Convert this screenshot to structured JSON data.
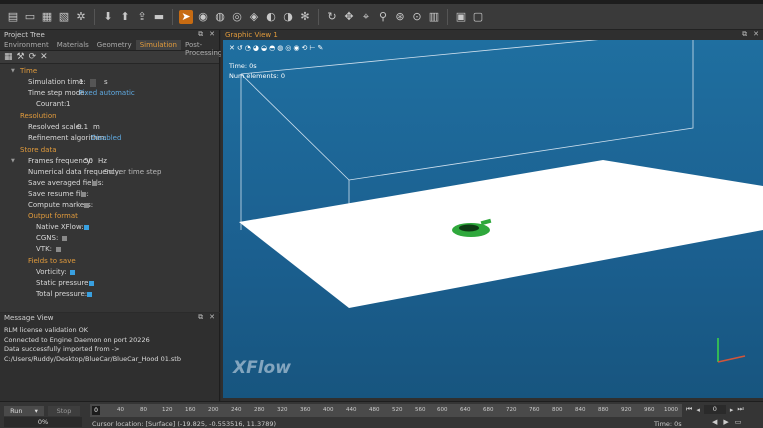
{
  "project_tree": {
    "title": "Project Tree",
    "tabs": [
      "Environment",
      "Materials",
      "Geometry",
      "Simulation",
      "Post-Processing"
    ],
    "active_tab": "Simulation",
    "time_section": "Time",
    "simulation_time_label": "Simulation time:",
    "simulation_time_value": "1",
    "simulation_time_unit": "s",
    "time_step_mode_label": "Time step mode:",
    "time_step_mode_value": "Fixed automatic",
    "courant_label": "Courant:",
    "courant_value": "1",
    "resolution_section": "Resolution",
    "resolved_scale_label": "Resolved scale:",
    "resolved_scale_value": "0.1",
    "resolved_scale_unit": "m",
    "refinement_label": "Refinement algorithm:",
    "refinement_value": "Disabled",
    "store_section": "Store data",
    "frames_freq_label": "Frames frequency:",
    "frames_freq_value": "50",
    "frames_freq_unit": "Hz",
    "numerical_freq_label": "Numerical data frequency:",
    "numerical_freq_value": "Solver time step",
    "save_averaged_label": "Save averaged fields:",
    "save_resume_label": "Save resume file:",
    "compute_markers_label": "Compute markers:",
    "output_format_section": "Output format",
    "native_label": "Native XFlow:",
    "cgns_label": "CGNS:",
    "vtk_label": "VTK:",
    "fields_section": "Fields to save",
    "vorticity_label": "Vorticity:",
    "static_pressure_label": "Static pressure:",
    "total_pressure_label": "Total pressure:"
  },
  "message_view": {
    "title": "Message View",
    "lines": [
      "RLM license validation OK",
      "Connected to Engine Daemon on port 20226",
      "Data successfully imported from ->",
      "C:/Users/Ruddy/Desktop/BlueCar/BlueCar_Hood 01.stb"
    ]
  },
  "graphic_view": {
    "title": "Graphic View 1",
    "time_text": "Time: 0s",
    "elements_text": "Num elements: 0",
    "logo": "XFlow"
  },
  "bottom": {
    "run_label": "Run",
    "stop_label": "Stop",
    "progress_text": "0%",
    "timeline_start": "0",
    "ticks": [
      "40",
      "80",
      "120",
      "160",
      "200",
      "240",
      "280",
      "320",
      "360",
      "400",
      "440",
      "480",
      "520",
      "560",
      "600",
      "640",
      "680",
      "720",
      "760",
      "800",
      "840",
      "880",
      "920",
      "960",
      "1000"
    ],
    "frame_value": "0",
    "cursor_location": "Cursor location: [Surface] (-19.825, -0.553516, 11.3789)",
    "time_right": "Time: 0s"
  },
  "colors": {
    "accent": "#e09a3c",
    "link": "#5fa9e0",
    "viewport": "#1b5f8f",
    "car": "#2fa83c"
  }
}
